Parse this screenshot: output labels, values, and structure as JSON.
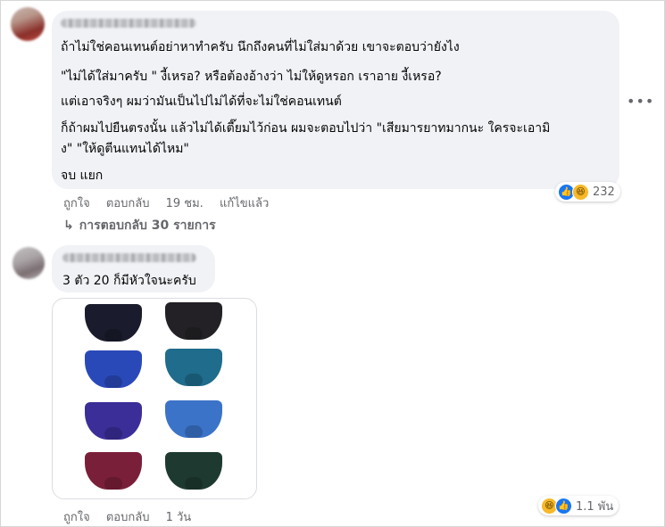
{
  "comment1": {
    "lines": [
      "ถ้าไม่ใช่คอนเทนต์อย่าหาทำครับ นึกถึงคนที่ไม่ใส่มาด้วย เขาจะตอบว่ายังไง",
      "\"ไม่ได้ใส่มาครับ \" งี้เหรอ? หรือต้องอ้างว่า ไม่ให้ดูหรอก เราอาย งี้เหรอ?",
      "แต่เอาจริงๆ ผมว่ามันเป็นไปไม่ได้ที่จะไม่ใช่คอนเทนต์",
      "ก็ถ้าผมไปยืนตรงนั้น แล้วไม่ได้เตี๊ยมไว้ก่อน ผมจะตอบไปว่า \"เสียมารยาทมากนะ ใครจะเอามิ",
      "ง\" \"ให้ดูตีนแทนได้ไหม\"",
      "จบ แยก"
    ],
    "reaction_count": "232",
    "actions": {
      "like": "ถูกใจ",
      "reply": "ตอบกลับ",
      "time": "19 ชม.",
      "edited": "แก้ไขแล้ว"
    },
    "replies_label": "การตอบกลับ 30 รายการ",
    "icons": [
      "avatar",
      "more-options-icon",
      "like-reaction-icon",
      "haha-reaction-icon",
      "reply-arrow-icon"
    ]
  },
  "comment2": {
    "text": "3 ตัว 20 ก็มีหัวใจนะครับ",
    "reaction_count": "1.1 พัน",
    "actions": {
      "like": "ถูกใจ",
      "reply": "ตอบกลับ",
      "time": "1 วัน"
    }
  },
  "colors": {
    "bubble": "#f0f2f5",
    "muted_text": "#65676b",
    "like_blue": "#1877f2",
    "haha_yellow": "#f7b928"
  }
}
